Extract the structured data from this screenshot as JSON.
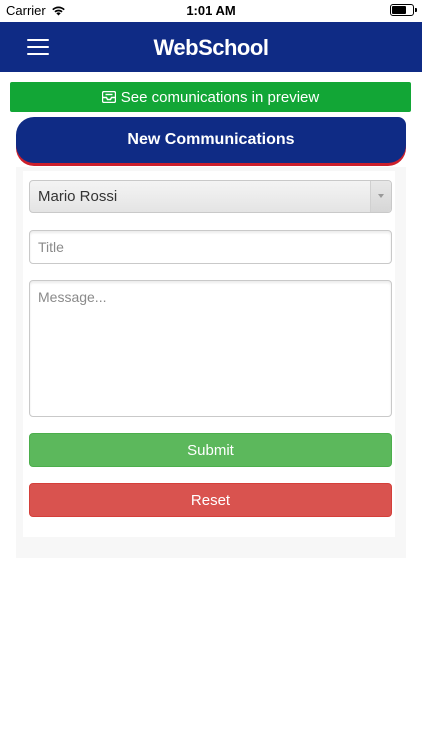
{
  "status_bar": {
    "carrier": "Carrier",
    "time": "1:01 AM",
    "wifi_icon": "wifi-icon",
    "battery_icon": "battery-icon"
  },
  "navbar": {
    "menu_icon": "hamburger-menu-icon",
    "brand": "WebSchool",
    "color": "#0f2b85"
  },
  "preview_button": {
    "icon": "inbox-icon",
    "label": "See comunications in preview",
    "color": "#12a636"
  },
  "card": {
    "title": "New Communications",
    "accent_color": "#cc1f2b"
  },
  "form": {
    "recipient_select": {
      "selected": "Mario Rossi"
    },
    "title_field": {
      "placeholder": "Title",
      "value": ""
    },
    "message_field": {
      "placeholder": "Message...",
      "value": ""
    },
    "submit_label": "Submit",
    "reset_label": "Reset",
    "submit_color": "#5cb85c",
    "reset_color": "#d9534f"
  }
}
